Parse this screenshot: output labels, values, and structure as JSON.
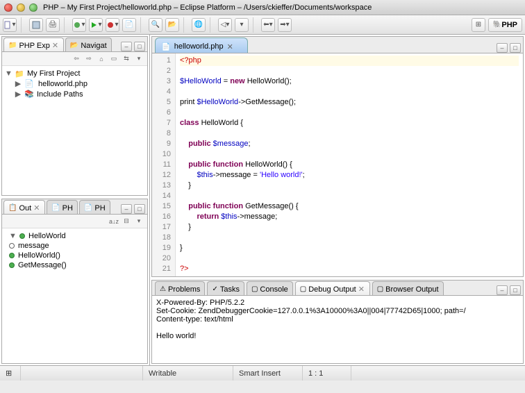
{
  "window": {
    "title": "PHP – My First Project/helloworld.php – Eclipse Platform – /Users/ckieffer/Documents/workspace"
  },
  "perspective": {
    "label": "PHP"
  },
  "views": {
    "explorer": {
      "tabs": [
        "PHP Exp",
        "Navigat"
      ],
      "project": "My First Project",
      "file": "helloworld.php",
      "include": "Include Paths"
    },
    "outline": {
      "tabs": [
        "Out",
        "PH",
        "PH"
      ],
      "root": "HelloWorld",
      "items": [
        "message",
        "HelloWorld()",
        "GetMessage()"
      ]
    }
  },
  "editor": {
    "filename": "helloworld.php",
    "lines": [
      "<?php",
      "",
      "$HelloWorld = new HelloWorld();",
      "",
      "print $HelloWorld->GetMessage();",
      "",
      "class HelloWorld {",
      "",
      "    public $message;",
      "",
      "    public function HelloWorld() {",
      "        $this->message = 'Hello world!';",
      "    }",
      "",
      "    public function GetMessage() {",
      "        return $this->message;",
      "    }",
      "",
      "}",
      "",
      "?>"
    ],
    "code": {
      "l1": "<?php",
      "l3_var": "$HelloWorld",
      "l3_rest": " = ",
      "l3_kw": "new",
      "l3_call": " HelloWorld();",
      "l5_pre": "print ",
      "l5_var": "$HelloWorld",
      "l5_rest": "->GetMessage();",
      "l7_kw": "class",
      "l7_name": " HelloWorld {",
      "l9_kw": "public",
      "l9_var": " $message",
      "l9_end": ";",
      "l11_kw": "public function",
      "l11_name": " HelloWorld() {",
      "l12_var": "$this",
      "l12_mid": "->message = ",
      "l12_str": "'Hello world!'",
      "l12_end": ";",
      "l13": "    }",
      "l15_kw": "public function",
      "l15_name": " GetMessage() {",
      "l16_kw": "return",
      "l16_var": " $this",
      "l16_rest": "->message;",
      "l17": "    }",
      "l19": "}",
      "l21": "?>"
    }
  },
  "bottom": {
    "tabs": [
      "Problems",
      "Tasks",
      "Console",
      "Debug Output",
      "Browser Output"
    ],
    "active": 3,
    "line1": "X-Powered-By: PHP/5.2.2",
    "line2": "Set-Cookie: ZendDebuggerCookie=127.0.0.1%3A10000%3A0||004|77742D65|1000; path=/",
    "line3": "Content-type: text/html",
    "line4": "",
    "line5": "Hello world!"
  },
  "status": {
    "writable": "Writable",
    "insert": "Smart Insert",
    "pos": "1 : 1"
  }
}
